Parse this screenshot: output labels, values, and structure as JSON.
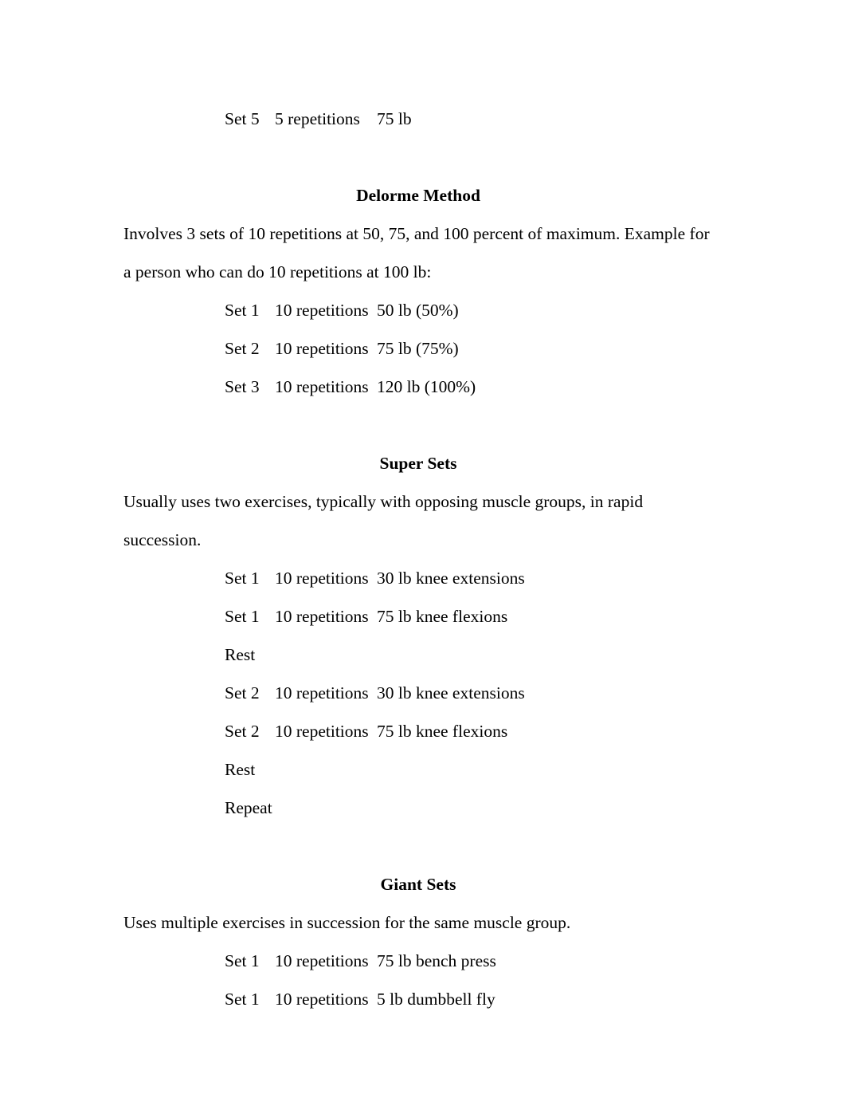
{
  "document": {
    "background_color": "#ffffff",
    "text_color": "#000000"
  },
  "top_orphan_row": {
    "set": "Set 5",
    "reps": "5 repetitions",
    "load": "75 lb"
  },
  "sections": [
    {
      "heading": "Delorme Method",
      "paragraph": "Involves 3 sets of 10 repetitions at 50, 75, and 100 percent of maximum. Example for a person who can do 10 repetitions at 100 lb:",
      "rows": [
        {
          "set": "Set 1",
          "reps": "10 repetitions",
          "load": "50 lb (50%)"
        },
        {
          "set": "Set 2",
          "reps": "10 repetitions",
          "load": "75 lb (75%)"
        },
        {
          "set": "Set 3",
          "reps": "10 repetitions",
          "load": "120 lb (100%)"
        }
      ]
    },
    {
      "heading": "Super Sets",
      "paragraph": "Usually uses two exercises, typically with opposing muscle groups, in rapid succession.",
      "rows": [
        {
          "set": "Set 1",
          "reps": "10 repetitions",
          "load": "30 lb knee extensions"
        },
        {
          "set": "Set 1",
          "reps": "10 repetitions",
          "load": "75 lb knee flexions"
        },
        {
          "set": "Rest",
          "reps": "",
          "load": ""
        },
        {
          "set": "Set 2",
          "reps": "10 repetitions",
          "load": "30 lb knee extensions"
        },
        {
          "set": "Set 2",
          "reps": "10 repetitions",
          "load": "75 lb knee flexions"
        },
        {
          "set": "Rest",
          "reps": "",
          "load": ""
        },
        {
          "set": "Repeat",
          "reps": "",
          "load": ""
        }
      ]
    },
    {
      "heading": "Giant Sets",
      "paragraph": "Uses multiple exercises in succession for the same muscle group.",
      "rows": [
        {
          "set": "Set 1",
          "reps": "10 repetitions",
          "load": "75 lb bench press"
        },
        {
          "set": "Set 1",
          "reps": "10 repetitions",
          "load": "5 lb dumbbell fly"
        }
      ]
    }
  ]
}
